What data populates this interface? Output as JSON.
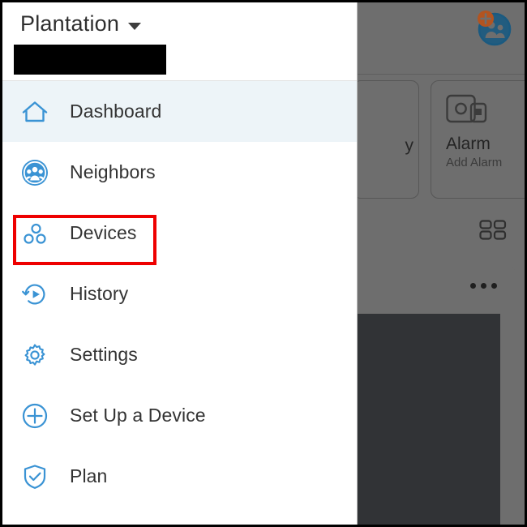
{
  "window": {
    "frame_color": "#000000"
  },
  "background_app": {
    "top_bar": {
      "neighbors_add_icon": "add-neighbor-icon"
    },
    "cards": [
      {
        "id": "partial-card",
        "visible_label": "y",
        "icon": ""
      },
      {
        "id": "alarm-card",
        "title": "Alarm",
        "subtitle": "Add Alarm",
        "icon": "alarm-base-station-icon"
      }
    ],
    "grid_toggle_icon": "grid-view-icon",
    "device_card": {
      "menu_icon": "more-options-icon",
      "thumbnail_color": "#313336"
    },
    "overlay_color": "#6e6e6e"
  },
  "sidebar": {
    "location": {
      "name": "Plantation",
      "dropdown_icon": "chevron-down-icon"
    },
    "redacted_field": "",
    "items": [
      {
        "label": "Dashboard",
        "icon": "home-icon",
        "active": true
      },
      {
        "label": "Neighbors",
        "icon": "neighbors-icon",
        "active": false
      },
      {
        "label": "Devices",
        "icon": "devices-icon",
        "active": false
      },
      {
        "label": "History",
        "icon": "history-icon",
        "active": false
      },
      {
        "label": "Settings",
        "icon": "gear-icon",
        "active": false
      },
      {
        "label": "Set Up a Device",
        "icon": "plus-circle-icon",
        "active": false
      },
      {
        "label": "Plan",
        "icon": "shield-check-icon",
        "active": false
      }
    ]
  },
  "annotation": {
    "target": "Devices",
    "color": "#ee0000"
  },
  "colors": {
    "accent_blue": "#3a93d4",
    "active_row": "#edf4f8",
    "text_dark": "#333333",
    "orange": "#b35420"
  }
}
